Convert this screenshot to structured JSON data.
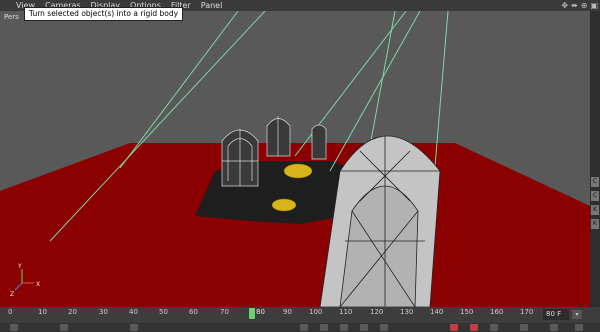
{
  "menu": {
    "items": [
      "View",
      "Cameras",
      "Display",
      "Options",
      "Filter",
      "Panel"
    ]
  },
  "tooltip": "Turn selected object(s) into a rigid body",
  "viewport": {
    "label": "Pers",
    "axis": {
      "x": "X",
      "y": "Y",
      "z": "Z"
    },
    "colors": {
      "background": "#595959",
      "floor": "#8b0000",
      "ground": "#1e1e1e",
      "wire": "#d9d9d9",
      "lines": "#7fd6a7",
      "gold": "#d6b51a"
    }
  },
  "right_strip": {
    "tabs": [
      "C",
      "C",
      "K",
      "K"
    ]
  },
  "timeline": {
    "ticks": [
      "0",
      "10",
      "20",
      "30",
      "40",
      "50",
      "60",
      "70",
      "80",
      "90",
      "100",
      "110",
      "120",
      "130",
      "140",
      "150",
      "160",
      "170"
    ],
    "current_frame": "80",
    "frame_field": "80 F",
    "frame_btn": "▾"
  }
}
